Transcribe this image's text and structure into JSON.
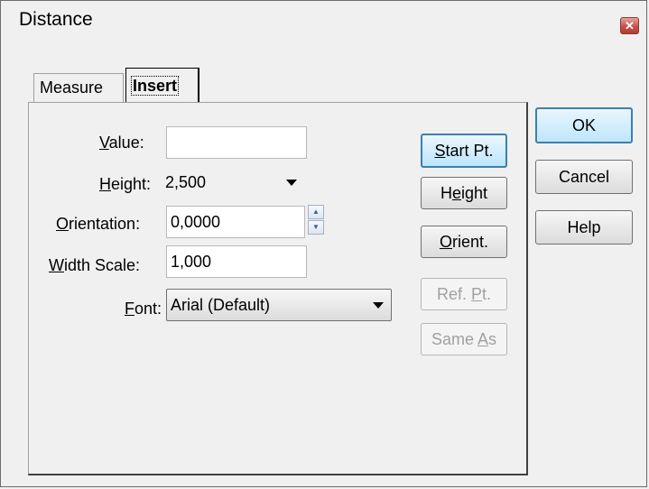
{
  "window": {
    "title": "Distance"
  },
  "tabs": [
    {
      "label": "Measure",
      "selected": false
    },
    {
      "label": "Insert",
      "selected": true
    }
  ],
  "form": {
    "value": {
      "label_pre": "",
      "label_u": "V",
      "label_post": "alue:",
      "value": ""
    },
    "height": {
      "label_pre": "",
      "label_u": "H",
      "label_post": "eight:",
      "value": "2,500"
    },
    "orientation": {
      "label_pre": "",
      "label_u": "O",
      "label_post": "rientation:",
      "value": "0,0000"
    },
    "width_scale": {
      "label_pre": "",
      "label_u": "W",
      "label_post": "idth Scale:",
      "value": "1,000"
    },
    "font": {
      "label_pre": "",
      "label_u": "F",
      "label_post": "ont:",
      "value": "Arial (Default)"
    }
  },
  "side_buttons": {
    "start_pt": {
      "pre": "",
      "u": "S",
      "post": "tart Pt.",
      "enabled": true
    },
    "height": {
      "pre": "H",
      "u": "e",
      "post": "ight",
      "enabled": true
    },
    "orient": {
      "pre": "",
      "u": "O",
      "post": "rient.",
      "enabled": true
    },
    "ref_pt": {
      "pre": "Ref. ",
      "u": "P",
      "post": "t.",
      "enabled": false
    },
    "same_as": {
      "pre": "Same ",
      "u": "A",
      "post": "s",
      "enabled": false
    }
  },
  "dialog_buttons": {
    "ok": "OK",
    "cancel": "Cancel",
    "help": "Help"
  },
  "icons": {
    "close": "close-icon",
    "spinner_up": "spin-up-icon",
    "spinner_down": "spin-down-icon",
    "dropdown": "chevron-down-icon"
  },
  "colors": {
    "default_button_border": "#3c7fb1",
    "close_button": "#c75050"
  }
}
